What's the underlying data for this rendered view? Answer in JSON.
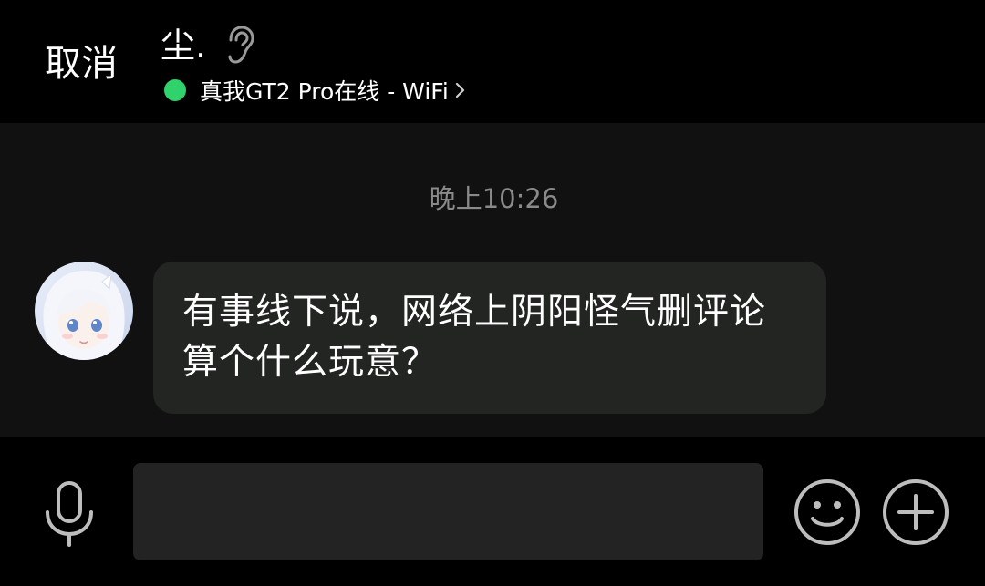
{
  "header": {
    "cancel_label": "取消",
    "contact_name": "尘.",
    "status_text": "真我GT2 Pro在线 - WiFi",
    "status_color": "#2fd26b",
    "icons": {
      "ear": "ear-icon",
      "chevron": "chevron-right-icon"
    }
  },
  "chat": {
    "timestamp": "晚上10:26",
    "messages": [
      {
        "direction": "incoming",
        "text": "有事线下说，网络上阴阳怪气删评论算个什么玩意？",
        "bubble_color": "#232523"
      }
    ]
  },
  "input_bar": {
    "value": "",
    "placeholder": "",
    "icons": {
      "mic": "microphone-icon",
      "emoji": "smiley-face-icon",
      "plus": "plus-circle-icon"
    }
  }
}
